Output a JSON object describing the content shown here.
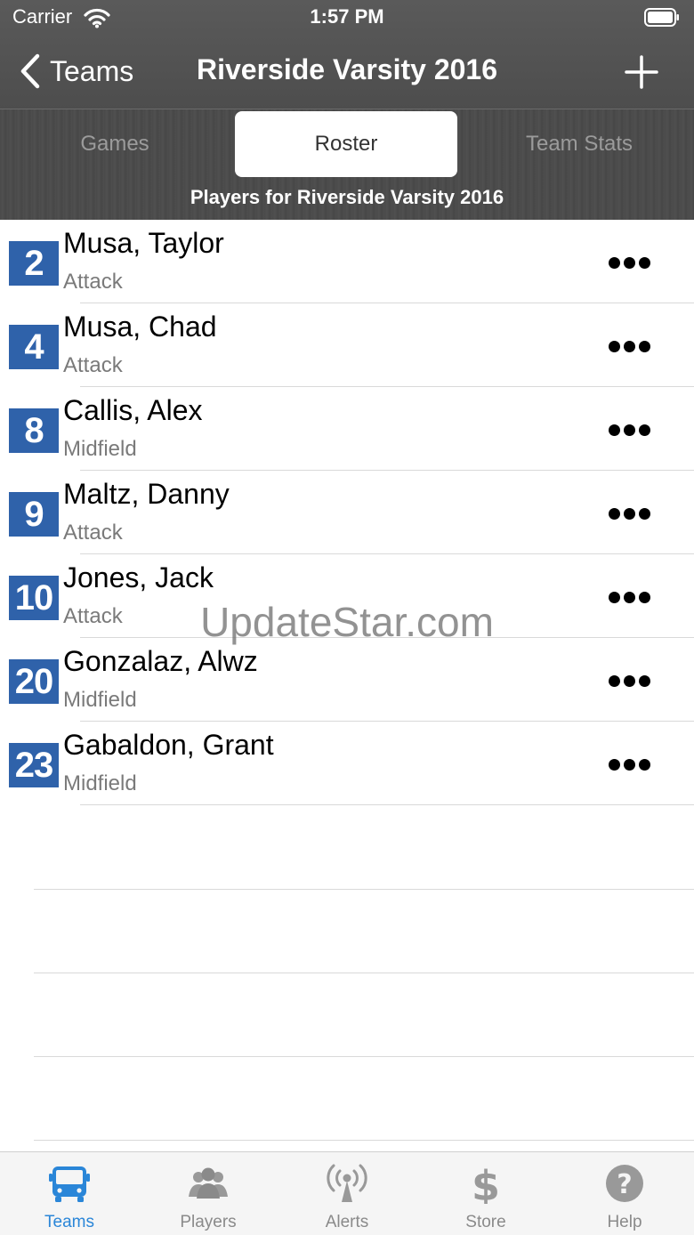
{
  "status_bar": {
    "carrier": "Carrier",
    "time": "1:57 PM"
  },
  "nav": {
    "back_label": "Teams",
    "title": "Riverside Varsity 2016"
  },
  "segments": {
    "games": "Games",
    "roster": "Roster",
    "team_stats": "Team Stats",
    "selected": "Roster"
  },
  "list_subtitle": "Players for Riverside Varsity 2016",
  "players": [
    {
      "number": "2",
      "name": "Musa, Taylor",
      "position": "Attack"
    },
    {
      "number": "4",
      "name": "Musa, Chad",
      "position": "Attack"
    },
    {
      "number": "8",
      "name": "Callis, Alex",
      "position": "Midfield"
    },
    {
      "number": "9",
      "name": "Maltz, Danny",
      "position": "Attack"
    },
    {
      "number": "10",
      "name": "Jones, Jack",
      "position": "Attack"
    },
    {
      "number": "20",
      "name": "Gonzalaz, Alwz",
      "position": "Midfield"
    },
    {
      "number": "23",
      "name": "Gabaldon, Grant",
      "position": "Midfield"
    }
  ],
  "watermark": "UpdateStar.com",
  "tabbar": {
    "teams": "Teams",
    "players": "Players",
    "alerts": "Alerts",
    "store": "Store",
    "help": "Help",
    "active": "Teams"
  },
  "colors": {
    "accent": "#2a86d8",
    "number_badge": "#2f62aa",
    "header": "#4d4d4d"
  }
}
